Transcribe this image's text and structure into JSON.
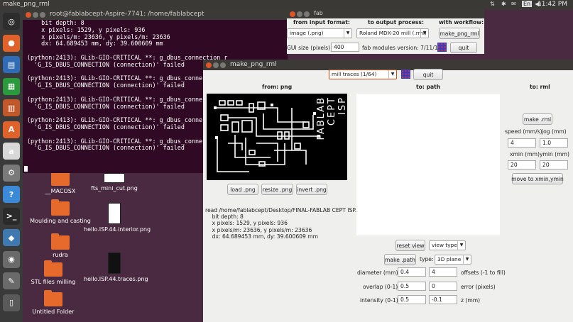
{
  "topbar": {
    "title": "make_png_rml",
    "lang": "En",
    "time": "11:42 PM"
  },
  "launcher": [
    {
      "name": "dash-icon",
      "glyph": "◎",
      "color": "#2d2d2d"
    },
    {
      "name": "firefox-icon",
      "glyph": "●",
      "color": "#e0622a"
    },
    {
      "name": "writer-icon",
      "glyph": "▤",
      "color": "#2f6cb5"
    },
    {
      "name": "calc-icon",
      "glyph": "▦",
      "color": "#2a9a3c"
    },
    {
      "name": "impress-icon",
      "glyph": "▥",
      "color": "#c0582a"
    },
    {
      "name": "software-center-icon",
      "glyph": "A",
      "color": "#e0622a"
    },
    {
      "name": "amazon-icon",
      "glyph": "a",
      "color": "#d8d8d8"
    },
    {
      "name": "settings-icon",
      "glyph": "⚙",
      "color": "#7a7a7a"
    },
    {
      "name": "help-icon",
      "glyph": "?",
      "color": "#3a8ad8"
    },
    {
      "name": "terminal-icon",
      "glyph": ">_",
      "color": "#2b2b2b"
    },
    {
      "name": "python-icon",
      "glyph": "◆",
      "color": "#3f79b0"
    },
    {
      "name": "disk-icon",
      "glyph": "◉",
      "color": "#6a6a6a"
    },
    {
      "name": "tools-icon",
      "glyph": "✎",
      "color": "#6a6a6a"
    },
    {
      "name": "trash-icon",
      "glyph": "▯",
      "color": "#5a5a5a"
    }
  ],
  "terminal": {
    "title": "root@fablabcept-Aspire-7741: /home/fablabcept",
    "lines": [
      "    bit depth: 8",
      "    x pixels: 1529, y pixels: 936",
      "    x pixels/m: 23636, y pixels/m: 23636",
      "    dx: 64.689453 mm, dy: 39.600609 mm",
      "",
      "(python:2413): GLib-GIO-CRITICAL **: g_dbus_connection_r",
      "  'G_IS_DBUS_CONNECTION (connection)' failed",
      "",
      "(python:2413): GLib-GIO-CRITICAL **: g_dbus_connection_r",
      "  'G_IS_DBUS_CONNECTION (connection)' failed",
      "",
      "(python:2413): GLib-GIO-CRITICAL **: g_dbus_connection_r",
      "  'G_IS_DBUS_CONNECTION (connection)' failed",
      "",
      "(python:2413): GLib-GIO-CRITICAL **: g_dbus_connection_r",
      "  'G_IS_DBUS_CONNECTION (connection)' failed",
      "",
      "(python:2413): GLib-GIO-CRITICAL **: g_dbus_connection_r",
      "  'G_IS_DBUS_CONNECTION (connection)' failed",
      ""
    ]
  },
  "desktop": {
    "left": [
      {
        "label": "__MACOSX",
        "type": "folder"
      },
      {
        "label": "Moulding and casting",
        "type": "folder"
      },
      {
        "label": "rudra",
        "type": "folder"
      },
      {
        "label": "STL files milling",
        "type": "folder"
      },
      {
        "label": "Untitled Folder",
        "type": "folder"
      }
    ],
    "right": [
      {
        "label": "fts_mini_cut.png",
        "type": "file"
      },
      {
        "label": "hello.ISP.44.interior.png",
        "type": "file"
      },
      {
        "label": "hello.ISP.44.traces.png",
        "type": "file"
      }
    ]
  },
  "fab": {
    "title": "fab",
    "from_label": "from input format:",
    "to_label": "to output process:",
    "with_label": "with workflow:",
    "input_format": "image (.png)",
    "output_process": "Roland MDX-20 mill (.rml)",
    "workflow_button": "make_png_rml",
    "gui_size_label": "GUI size (pixels):",
    "gui_size_value": "400",
    "version": "fab modules version: 7/11/14",
    "quit": "quit"
  },
  "png": {
    "title": "make_png_rml",
    "mode": "mill traces (1/64)",
    "quit": "quit",
    "col_png": "from: png",
    "col_path": "to: path",
    "col_rml": "to: rml",
    "load_png": "load .png",
    "resize_png": "resize .png",
    "invert_png": "invert .png",
    "pcb_text": [
      "FABLAB",
      "CEPT",
      "ISP"
    ],
    "readout": [
      "read /home/fablabcept/Desktop/FINAL-FABLAB CEPT ISP.png",
      "    bit depth: 8",
      "    x pixels: 1529, y pixels: 936",
      "    x pixels/m: 23636, y pixels/m: 23636",
      "    dx: 64.689453 mm, dy: 39.600609 mm"
    ],
    "reset_view": "reset view",
    "view_type": "view type",
    "make_path": "make .path",
    "type_label": "type:",
    "type_value": "3D plane",
    "diameter_label": "diameter (mm)",
    "diameter_value": "0.4",
    "offsets_value": "4",
    "offsets_label": "offsets (-1 to fill)",
    "overlap_label": "overlap (0-1)",
    "overlap_value": "0.5",
    "error_value": "0",
    "error_label": "error (pixels)",
    "intensity_label": "intensity (0-1)",
    "intensity_value": "0.5",
    "z_value": "-0.1",
    "z_label": "z (mm)",
    "make_rml": "make .rml",
    "speed_label": "speed (mm/s)",
    "jog_label": "jog (mm)",
    "speed_value": "4",
    "jog_value": "1.0",
    "xmin_label": "xmin (mm)",
    "ymin_label": "ymin (mm)",
    "xmin_value": "20",
    "ymin_value": "20",
    "move_to": "move to xmin,ymin"
  }
}
